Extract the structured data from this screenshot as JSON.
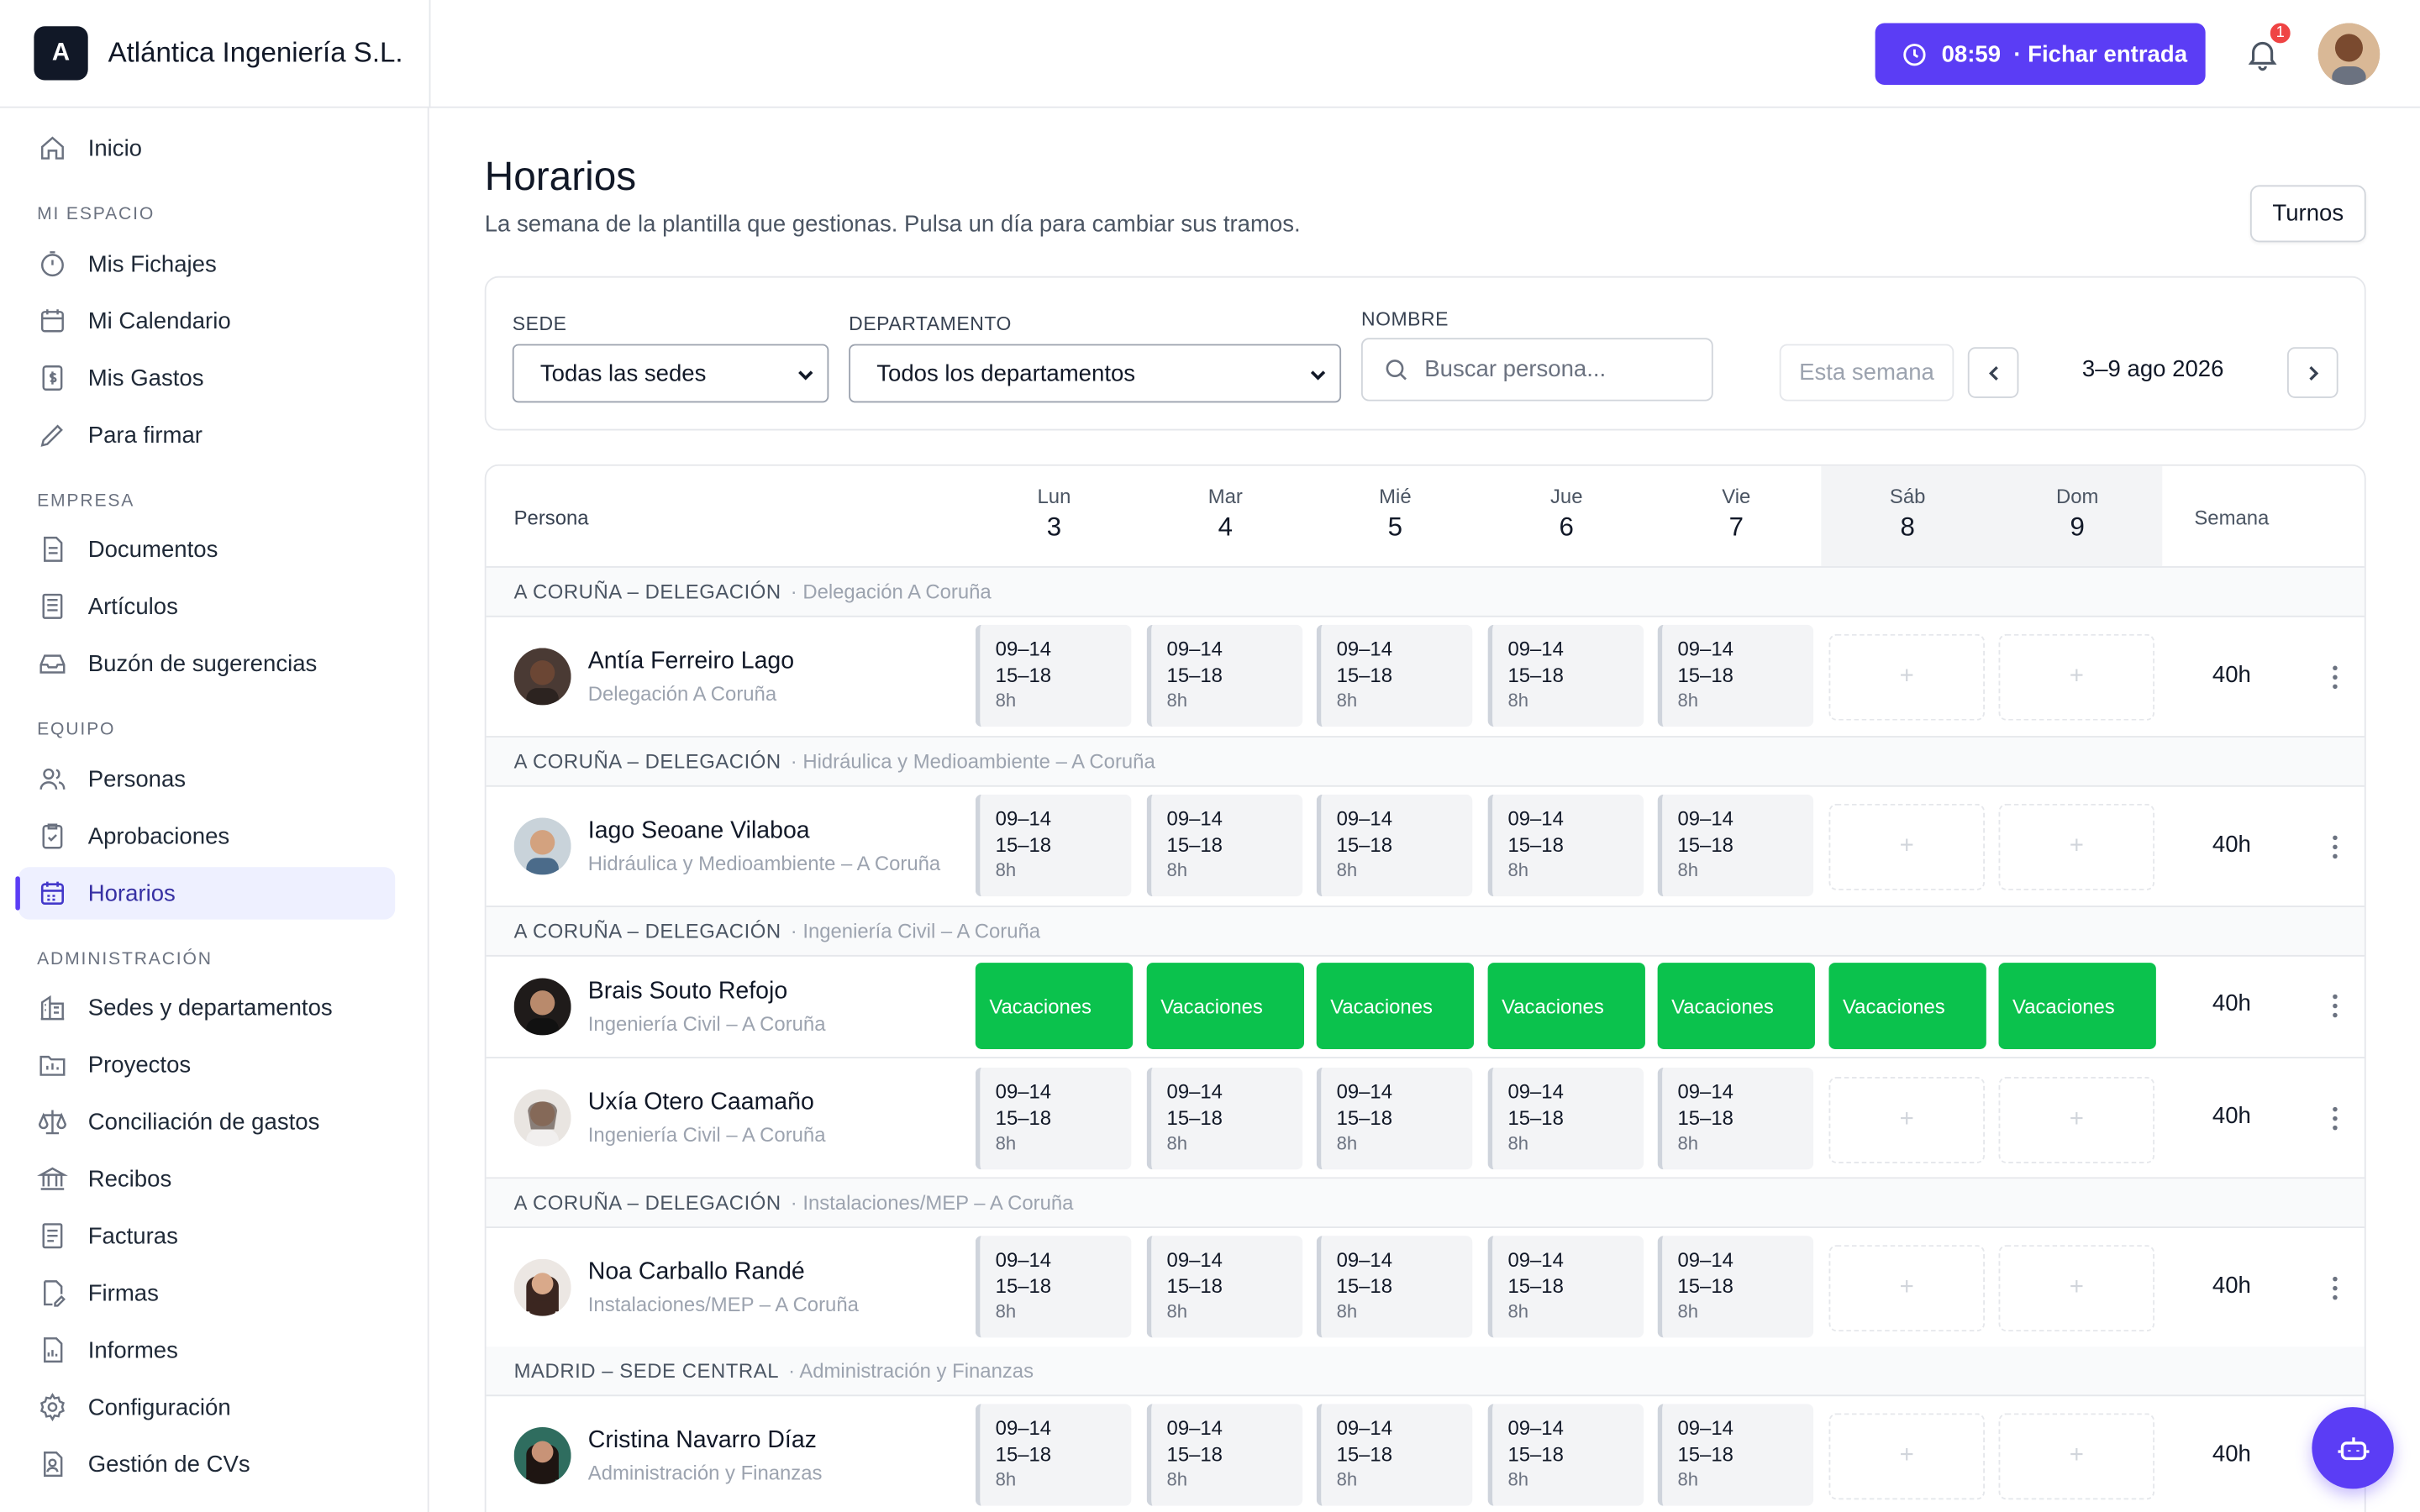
{
  "app": {
    "logo_letter": "A",
    "company": "Atlántica Ingeniería S.L."
  },
  "topbar": {
    "clock_label": "08:59  · Fichar entrada",
    "notifications": "1"
  },
  "sidebar": {
    "inicio": "Inicio",
    "section_mi_espacio": "MI ESPACIO",
    "mis_fichajes": "Mis Fichajes",
    "mi_calendario": "Mi Calendario",
    "mis_gastos": "Mis Gastos",
    "para_firmar": "Para firmar",
    "section_empresa": "EMPRESA",
    "documentos": "Documentos",
    "articulos": "Artículos",
    "buzon": "Buzón de sugerencias",
    "section_equipo": "EQUIPO",
    "personas": "Personas",
    "aprobaciones": "Aprobaciones",
    "horarios": "Horarios",
    "section_admin": "ADMINISTRACIÓN",
    "sedes": "Sedes y departamentos",
    "proyectos": "Proyectos",
    "conciliacion": "Conciliación de gastos",
    "recibos": "Recibos",
    "facturas": "Facturas",
    "firmas": "Firmas",
    "informes": "Informes",
    "configuracion": "Configuración",
    "cvs": "Gestión de CVs"
  },
  "page": {
    "title": "Horarios",
    "subtitle": "La semana de la plantilla que gestionas. Pulsa un día para cambiar sus tramos.",
    "turnos": "Turnos"
  },
  "filters": {
    "sede_label": "SEDE",
    "sede_value": "Todas las sedes",
    "dept_label": "DEPARTAMENTO",
    "dept_value": "Todos los departamentos",
    "nombre_label": "NOMBRE",
    "search_placeholder": "Buscar persona...",
    "week_button": "Esta semana",
    "week_range": "3–9 ago 2026"
  },
  "grid": {
    "col_persona": "Persona",
    "col_semana": "Semana",
    "days": [
      {
        "name": "Lun",
        "num": "3"
      },
      {
        "name": "Mar",
        "num": "4"
      },
      {
        "name": "Mié",
        "num": "5"
      },
      {
        "name": "Jue",
        "num": "6"
      },
      {
        "name": "Vie",
        "num": "7"
      },
      {
        "name": "Sáb",
        "num": "8"
      },
      {
        "name": "Dom",
        "num": "9"
      }
    ],
    "groups": [
      {
        "sede": "A CORUÑA – DELEGACIÓN",
        "dept": "· Delegación A Coruña"
      },
      {
        "sede": "A CORUÑA – DELEGACIÓN",
        "dept": "· Hidráulica y Medioambiente – A Coruña"
      },
      {
        "sede": "A CORUÑA – DELEGACIÓN",
        "dept": "· Ingeniería Civil – A Coruña"
      },
      {
        "sede": "A CORUÑA – DELEGACIÓN",
        "dept": "· Instalaciones/MEP – A Coruña"
      },
      {
        "sede": "MADRID – SEDE CENTRAL",
        "dept": "· Administración y Finanzas"
      }
    ],
    "shift": {
      "t1": "09–14",
      "t2": "15–18",
      "hours": "8h"
    },
    "vacation": "Vacaciones",
    "empty": "+",
    "people": [
      {
        "name": "Antía Ferreiro Lago",
        "dept": "Delegación A Coruña",
        "total": "40h"
      },
      {
        "name": "Iago Seoane Vilaboa",
        "dept": "Hidráulica y Medioambiente – A Coruña",
        "total": "40h"
      },
      {
        "name": "Brais Souto Refojo",
        "dept": "Ingeniería Civil – A Coruña",
        "total": "40h"
      },
      {
        "name": "Uxía Otero Caamaño",
        "dept": "Ingeniería Civil – A Coruña",
        "total": "40h"
      },
      {
        "name": "Noa Carballo Randé",
        "dept": "Instalaciones/MEP – A Coruña",
        "total": "40h"
      },
      {
        "name": "Cristina Navarro Díaz",
        "dept": "Administración y Finanzas",
        "total": "40h"
      }
    ]
  },
  "colors": {
    "accent": "#5b3df5",
    "vacation": "#0bc24d",
    "badge": "#ef4444"
  }
}
